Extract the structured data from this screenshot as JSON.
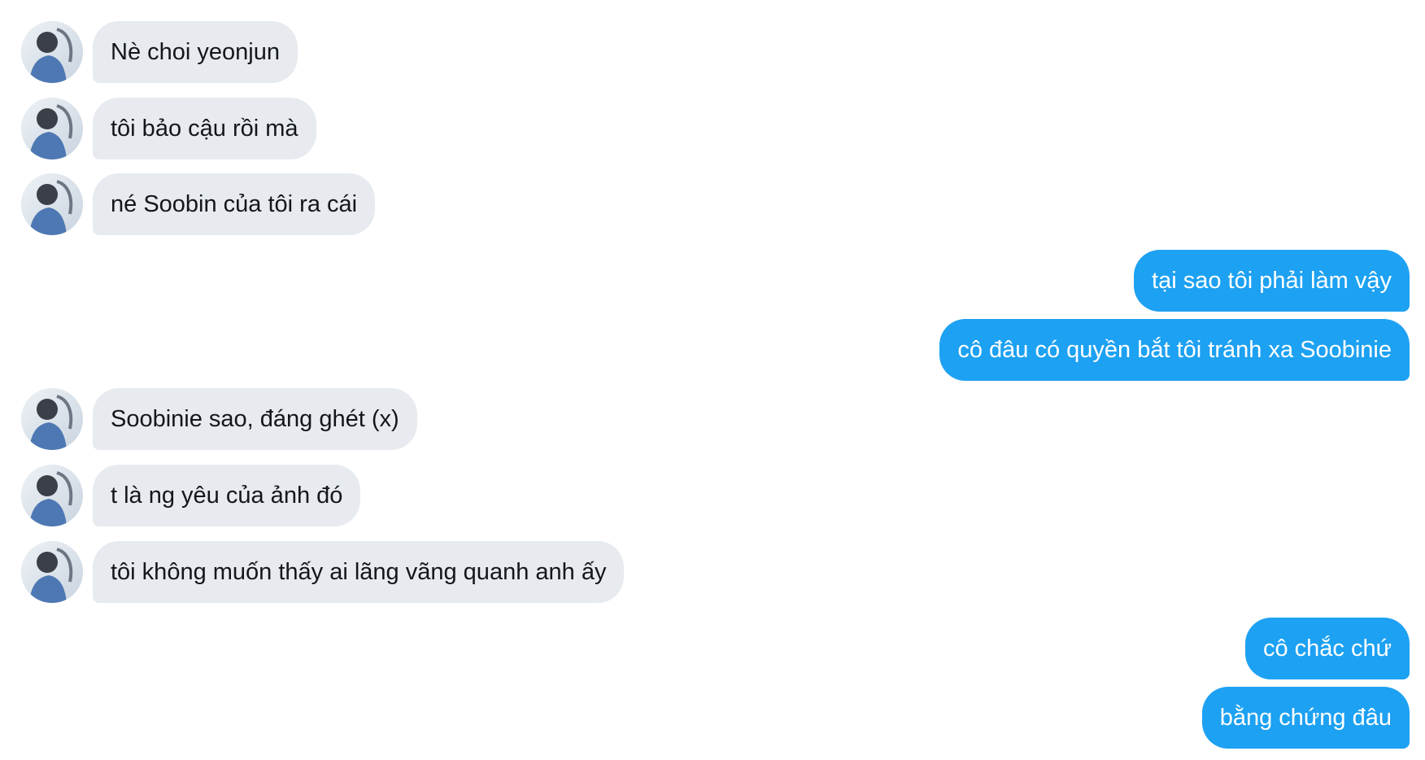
{
  "colors": {
    "incoming_bubble": "#e7ebef",
    "incoming_text": "#14171a",
    "outgoing_bubble": "#1da1f2",
    "outgoing_text": "#ffffff",
    "background": "#ffffff"
  },
  "icons": {
    "avatar": "user-avatar-photo"
  },
  "messages": [
    {
      "side": "incoming",
      "text": "Nè choi yeonjun"
    },
    {
      "side": "incoming",
      "text": "tôi bảo cậu rồi mà"
    },
    {
      "side": "incoming",
      "text": "né Soobin của tôi ra cái"
    },
    {
      "side": "outgoing",
      "text": "tại sao tôi phải làm vậy"
    },
    {
      "side": "outgoing",
      "text": "cô đâu có quyền bắt tôi tránh xa Soobinie"
    },
    {
      "side": "incoming",
      "text": "Soobinie sao, đáng ghét (x)"
    },
    {
      "side": "incoming",
      "text": "t là ng yêu của ảnh đó"
    },
    {
      "side": "incoming",
      "text": "tôi không muốn thấy ai lãng vãng quanh anh ấy"
    },
    {
      "side": "outgoing",
      "text": "cô chắc chứ"
    },
    {
      "side": "outgoing",
      "text": "bằng chứng đâu"
    }
  ]
}
